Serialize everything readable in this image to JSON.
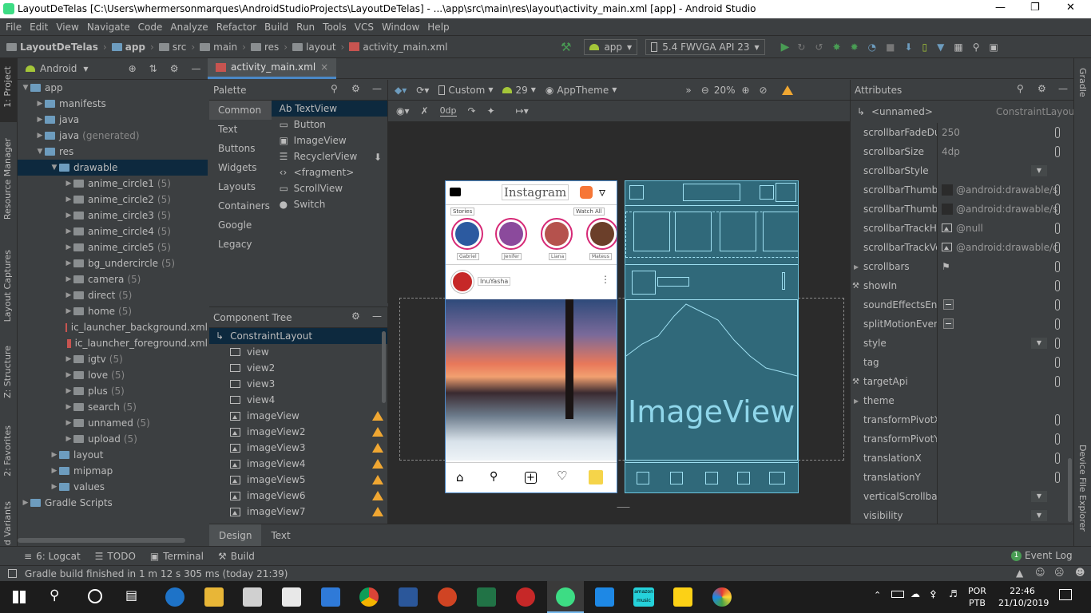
{
  "window": {
    "title": "LayoutDeTelas [C:\\Users\\whermersonmarques\\AndroidStudioProjects\\LayoutDeTelas] - ...\\app\\src\\main\\res\\layout\\activity_main.xml [app] - Android Studio"
  },
  "menu": [
    "File",
    "Edit",
    "View",
    "Navigate",
    "Code",
    "Analyze",
    "Refactor",
    "Build",
    "Run",
    "Tools",
    "VCS",
    "Window",
    "Help"
  ],
  "breadcrumbs": [
    "LayoutDeTelas",
    "app",
    "src",
    "main",
    "res",
    "layout",
    "activity_main.xml"
  ],
  "toolbar": {
    "run_config": "app",
    "device": "5.4  FWVGA API 23"
  },
  "left_strip": {
    "project": "1: Project",
    "resource_manager": "Resource Manager",
    "layout_captures": "Layout Captures",
    "structure": "Z: Structure",
    "favorites": "2: Favorites",
    "build_variants": "ld Variants"
  },
  "right_strip": {
    "gradle": "Gradle",
    "device_explorer": "Device File Explorer"
  },
  "project": {
    "view_mode": "Android",
    "tree": [
      {
        "label": "app",
        "depth": 0,
        "expanded": true,
        "kind": "module"
      },
      {
        "label": "manifests",
        "depth": 1,
        "kind": "folder"
      },
      {
        "label": "java",
        "depth": 1,
        "kind": "folder"
      },
      {
        "label": "java",
        "suffix": "(generated)",
        "depth": 1,
        "kind": "folder"
      },
      {
        "label": "res",
        "depth": 1,
        "expanded": true,
        "kind": "folder"
      },
      {
        "label": "drawable",
        "depth": 2,
        "expanded": true,
        "kind": "folder",
        "selected": true
      },
      {
        "label": "anime_circle1",
        "count": "(5)",
        "depth": 3,
        "kind": "folder"
      },
      {
        "label": "anime_circle2",
        "count": "(5)",
        "depth": 3,
        "kind": "folder"
      },
      {
        "label": "anime_circle3",
        "count": "(5)",
        "depth": 3,
        "kind": "folder"
      },
      {
        "label": "anime_circle4",
        "count": "(5)",
        "depth": 3,
        "kind": "folder"
      },
      {
        "label": "anime_circle5",
        "count": "(5)",
        "depth": 3,
        "kind": "folder"
      },
      {
        "label": "bg_undercircle",
        "count": "(5)",
        "depth": 3,
        "kind": "folder"
      },
      {
        "label": "camera",
        "count": "(5)",
        "depth": 3,
        "kind": "folder"
      },
      {
        "label": "direct",
        "count": "(5)",
        "depth": 3,
        "kind": "folder"
      },
      {
        "label": "home",
        "count": "(5)",
        "depth": 3,
        "kind": "folder"
      },
      {
        "label": "ic_launcher_background.xml",
        "depth": 3,
        "kind": "xml"
      },
      {
        "label": "ic_launcher_foreground.xml",
        "depth": 3,
        "kind": "xml"
      },
      {
        "label": "igtv",
        "count": "(5)",
        "depth": 3,
        "kind": "folder"
      },
      {
        "label": "love",
        "count": "(5)",
        "depth": 3,
        "kind": "folder"
      },
      {
        "label": "plus",
        "count": "(5)",
        "depth": 3,
        "kind": "folder"
      },
      {
        "label": "search",
        "count": "(5)",
        "depth": 3,
        "kind": "folder"
      },
      {
        "label": "unnamed",
        "count": "(5)",
        "depth": 3,
        "kind": "folder"
      },
      {
        "label": "upload",
        "count": "(5)",
        "depth": 3,
        "kind": "folder"
      },
      {
        "label": "layout",
        "depth": 2,
        "kind": "folder"
      },
      {
        "label": "mipmap",
        "depth": 2,
        "kind": "folder"
      },
      {
        "label": "values",
        "depth": 2,
        "kind": "folder"
      },
      {
        "label": "Gradle Scripts",
        "depth": 0,
        "kind": "gradle"
      }
    ]
  },
  "editor_tab": "activity_main.xml",
  "palette": {
    "title": "Palette",
    "categories": [
      "Common",
      "Text",
      "Buttons",
      "Widgets",
      "Layouts",
      "Containers",
      "Google",
      "Legacy"
    ],
    "items": [
      "Ab TextView",
      "Button",
      "ImageView",
      "RecyclerView",
      "<fragment>",
      "ScrollView",
      "Switch"
    ]
  },
  "component_tree": {
    "title": "Component Tree",
    "root": "ConstraintLayout",
    "items": [
      {
        "label": "view",
        "kind": "view"
      },
      {
        "label": "view2",
        "kind": "view"
      },
      {
        "label": "view3",
        "kind": "view"
      },
      {
        "label": "view4",
        "kind": "view"
      },
      {
        "label": "imageView",
        "kind": "image",
        "warn": true
      },
      {
        "label": "imageView2",
        "kind": "image",
        "warn": true
      },
      {
        "label": "imageView3",
        "kind": "image",
        "warn": true
      },
      {
        "label": "imageView4",
        "kind": "image",
        "warn": true
      },
      {
        "label": "imageView5",
        "kind": "image",
        "warn": true
      },
      {
        "label": "imageView6",
        "kind": "image",
        "warn": true
      },
      {
        "label": "imageView7",
        "kind": "image",
        "warn": true
      }
    ]
  },
  "design_toolbar": {
    "custom": "Custom",
    "api": "29",
    "theme": "AppTheme",
    "zoom": "20%",
    "margin": "0dp"
  },
  "preview": {
    "app_title": "Instagram",
    "stories_label": "Stories",
    "watch_all": "Watch All",
    "story_names": [
      "Gabriel",
      "Jenifer",
      "Liana",
      "Mateus"
    ],
    "post_user": "InuYasha",
    "blueprint_label": "ImageView"
  },
  "attributes": {
    "title": "Attributes",
    "component": "<unnamed>",
    "component_type": "ConstraintLayout",
    "rows": [
      {
        "name": "scrollbarFadeDura",
        "value": "250",
        "ctrl": "pill"
      },
      {
        "name": "scrollbarSize",
        "value": "4dp",
        "ctrl": "pill"
      },
      {
        "name": "scrollbarStyle",
        "value": "",
        "ctrl": "dropdown"
      },
      {
        "name": "scrollbarThumbHo",
        "value": "@android:drawable/s",
        "ctrl": "pill",
        "swatch": true
      },
      {
        "name": "scrollbarThumbVe",
        "value": "@android:drawable/s",
        "ctrl": "pill",
        "swatch": true
      },
      {
        "name": "scrollbarTrackHor",
        "value": "@null",
        "ctrl": "pill",
        "img": true
      },
      {
        "name": "scrollbarTrackVert",
        "value": "@android:drawable/c",
        "ctrl": "pill",
        "img": true
      },
      {
        "name": "scrollbars",
        "value": "",
        "ctrl": "pill",
        "group": true,
        "flag": true
      },
      {
        "name": "showIn",
        "value": "",
        "ctrl": "pill",
        "tool": true
      },
      {
        "name": "soundEffectsEnab",
        "value": "",
        "ctrl": "pill",
        "check": true
      },
      {
        "name": "splitMotionEvents",
        "value": "",
        "ctrl": "pill",
        "check": true
      },
      {
        "name": "style",
        "value": "",
        "ctrl": "dropdown+pill"
      },
      {
        "name": "tag",
        "value": "",
        "ctrl": "pill"
      },
      {
        "name": "targetApi",
        "value": "",
        "ctrl": "pill",
        "tool": true
      },
      {
        "name": "theme",
        "value": "",
        "ctrl": "",
        "group": true
      },
      {
        "name": "transformPivotX",
        "value": "",
        "ctrl": "pill"
      },
      {
        "name": "transformPivotY",
        "value": "",
        "ctrl": "pill"
      },
      {
        "name": "translationX",
        "value": "",
        "ctrl": "pill"
      },
      {
        "name": "translationY",
        "value": "",
        "ctrl": "pill"
      },
      {
        "name": "verticalScrollbarPo",
        "value": "",
        "ctrl": "dropdown"
      },
      {
        "name": "visibility",
        "value": "",
        "ctrl": "dropdown"
      }
    ]
  },
  "design_tabs": [
    "Design",
    "Text"
  ],
  "bottom_tabs": [
    "6: Logcat",
    "TODO",
    "Terminal",
    "Build"
  ],
  "event_log": {
    "badge": "1",
    "label": "Event Log"
  },
  "status": "Gradle build finished in 1 m 12 s 305 ms (today 21:39)",
  "taskbar": {
    "lang1": "POR",
    "lang2": "PTB",
    "time": "22:46",
    "date": "21/10/2019",
    "amazon1": "amazon",
    "amazon2": "music"
  },
  "colors": {
    "accent": "#4a88c7",
    "selection": "#0d293e",
    "warning": "#f0a732",
    "blueprint": "#30697a",
    "run_green": "#499c54"
  }
}
